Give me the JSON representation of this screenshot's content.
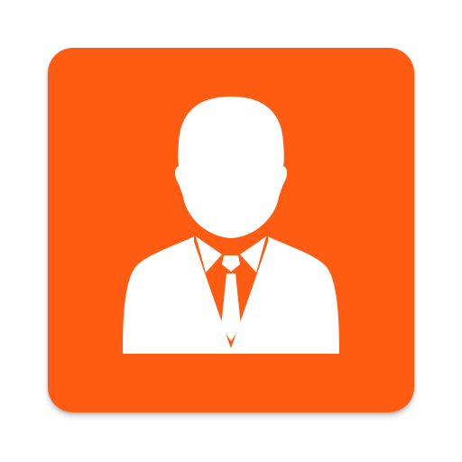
{
  "app_icon": {
    "label": "",
    "icon": "businessman-icon",
    "colors": {
      "background": "#FF5C13",
      "figure": "#FFFFFF"
    }
  }
}
